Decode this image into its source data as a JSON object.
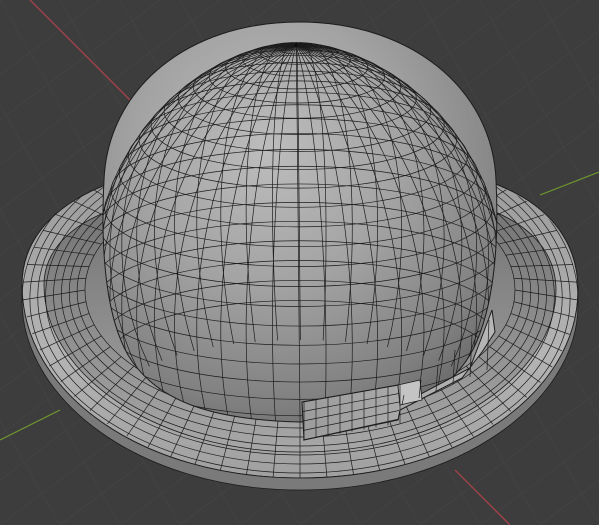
{
  "viewport": {
    "background_color": "#3d3d3d",
    "grid_line_color": "#464646",
    "x_axis_color": "#b0424c",
    "y_axis_color": "#6f9b2e",
    "mesh_fill_color": "#8f8f8f",
    "wireframe_color": "#1c1c1c",
    "object": "bowler-hat-mesh",
    "shading_mode": "solid-with-wireframe",
    "visible_parts": [
      "crown",
      "brim",
      "hat-band",
      "bow"
    ]
  }
}
